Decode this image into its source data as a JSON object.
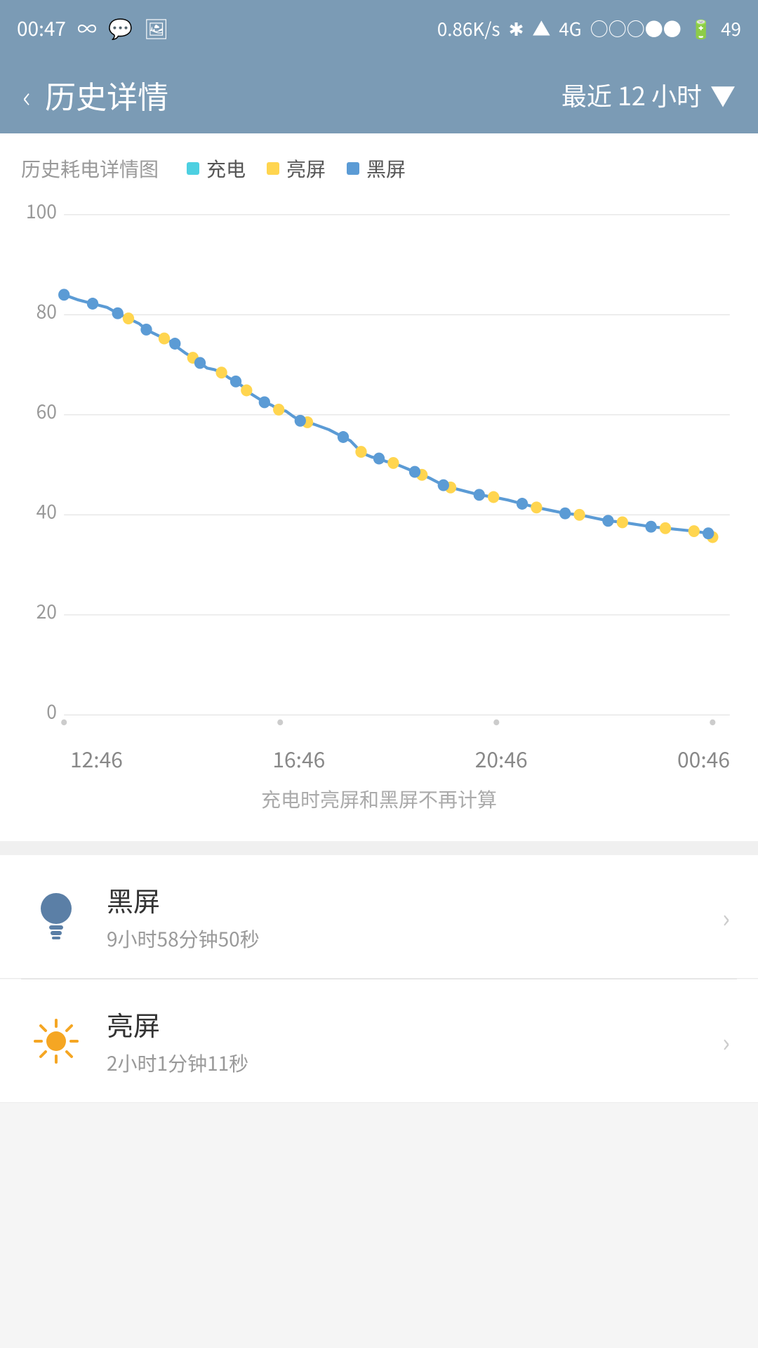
{
  "statusBar": {
    "time": "00:47",
    "speed": "0.86",
    "speedUnit": "K/s",
    "batteryPercent": "49"
  },
  "header": {
    "backLabel": "‹",
    "title": "历史详情",
    "filterLabel": "最近 12 小时",
    "dropdownIcon": "▼"
  },
  "chart": {
    "legendTitle": "历史耗电详情图",
    "legend": [
      {
        "label": "充电",
        "color": "#4dd0e1"
      },
      {
        "label": "亮屏",
        "color": "#ffd54f"
      },
      {
        "label": "黑屏",
        "color": "#5b9bd5"
      }
    ],
    "yAxisLabels": [
      "100",
      "80",
      "60",
      "40",
      "20",
      "0"
    ],
    "xAxisLabels": [
      "12:46",
      "16:46",
      "20:46",
      "00:46"
    ],
    "note": "充电时亮屏和黑屏不再计算"
  },
  "listItems": [
    {
      "id": "black-screen",
      "icon": "bulb-off",
      "iconColor": "#5b7fa6",
      "title": "黑屏",
      "subtitle": "9小时58分钟50秒",
      "hasArrow": true
    },
    {
      "id": "bright-screen",
      "icon": "sun",
      "iconColor": "#f5a623",
      "title": "亮屏",
      "subtitle": "2小时1分钟11秒",
      "hasArrow": true
    }
  ]
}
